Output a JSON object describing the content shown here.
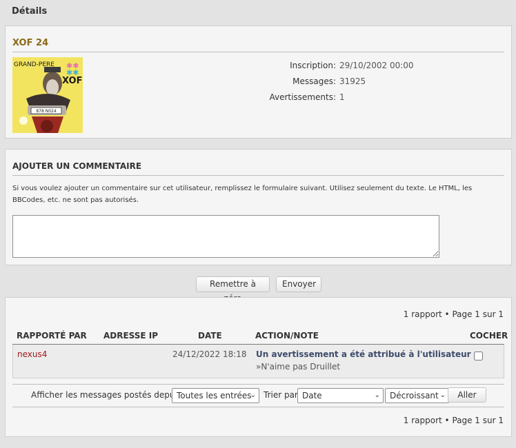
{
  "page": {
    "heading": "Détails"
  },
  "user": {
    "name": "XOF 24",
    "avatar_text": {
      "top": "GRAND-PERE",
      "brand": "XOF",
      "plate": "878 N024"
    },
    "stats": [
      {
        "label": "Inscription:",
        "value": "29/10/2002 00:00"
      },
      {
        "label": "Messages:",
        "value": "31925"
      },
      {
        "label": "Avertissements:",
        "value": "1"
      }
    ]
  },
  "comment": {
    "title": "AJOUTER UN COMMENTAIRE",
    "help": "Si vous voulez ajouter un commentaire sur cet utilisateur, remplissez le formulaire suivant. Utilisez seulement du texte. Le HTML, les BBCodes, etc. ne sont pas autorisés.",
    "value": ""
  },
  "form_buttons": {
    "reset": "Remettre à zéro",
    "submit": "Envoyer"
  },
  "reports": {
    "pagination": "1 rapport • Page 1 sur 1",
    "columns": {
      "reporter": "RAPPORTÉ PAR",
      "ip": "ADRESSE IP",
      "date": "DATE",
      "action": "ACTION/NOTE",
      "check": "COCHER"
    },
    "rows": [
      {
        "reporter": "nexus4",
        "ip": "",
        "date": "24/12/2022 18:18",
        "action_title": "Un avertissement a été attribué à l'utilisateur",
        "action_note": "»N'aime pas Druillet",
        "checked": false
      }
    ],
    "filter": {
      "since_label": "Afficher les messages postés depuis:",
      "since_value": "Toutes les entrées",
      "sort_label": "Trier par",
      "sort_value": "Date",
      "order_value": "Décroissant",
      "go_label": "Aller"
    }
  },
  "colors": {
    "username": "#8a6a16",
    "reporter_link": "#a01a1a",
    "action_title": "#3d4b6b",
    "panel_bg": "#f5f5f5",
    "page_bg": "#e3e3e3"
  }
}
